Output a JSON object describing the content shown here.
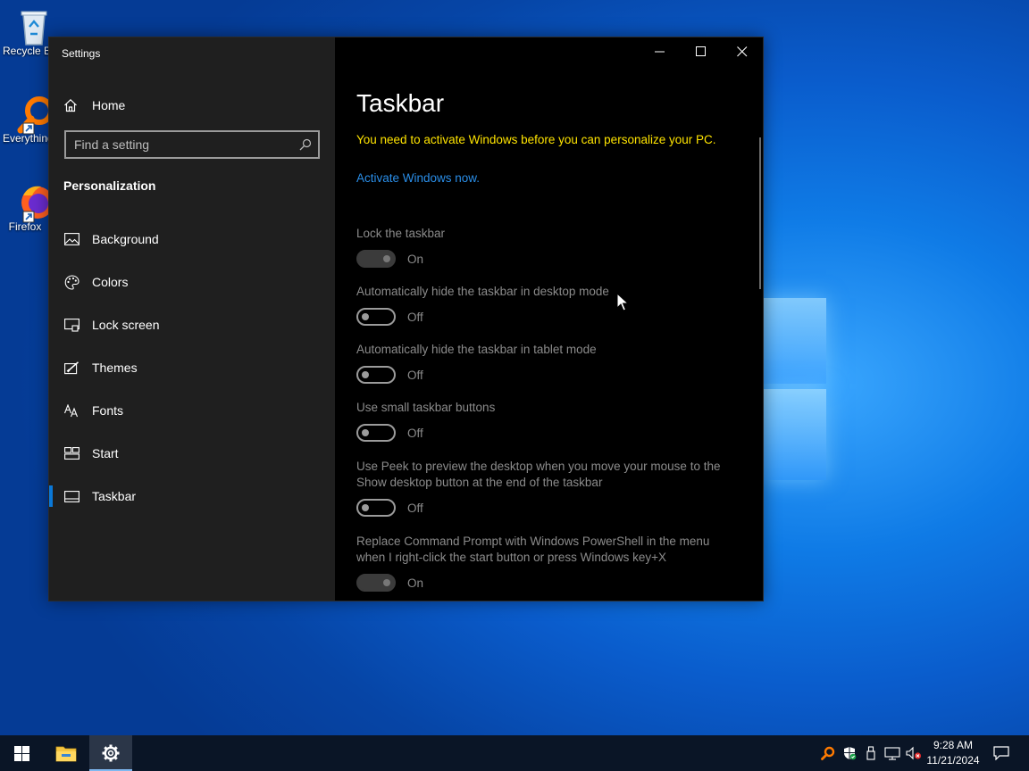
{
  "desktop": {
    "icons": [
      {
        "label": "Recycle Bin",
        "icon": "recycle-bin-icon"
      },
      {
        "label": "Everything",
        "icon": "everything-search-icon"
      },
      {
        "label": "Firefox",
        "icon": "firefox-icon"
      }
    ]
  },
  "window": {
    "title": "Settings",
    "controls": [
      "minimize-icon",
      "maximize-icon",
      "close-icon"
    ]
  },
  "sidebar": {
    "home_label": "Home",
    "search_placeholder": "Find a setting",
    "section_title": "Personalization",
    "items": [
      {
        "label": "Background",
        "icon": "picture-icon",
        "selected": false
      },
      {
        "label": "Colors",
        "icon": "palette-icon",
        "selected": false
      },
      {
        "label": "Lock screen",
        "icon": "lock-screen-icon",
        "selected": false
      },
      {
        "label": "Themes",
        "icon": "themes-brush-icon",
        "selected": false
      },
      {
        "label": "Fonts",
        "icon": "fonts-icon",
        "selected": false
      },
      {
        "label": "Start",
        "icon": "start-tiles-icon",
        "selected": false
      },
      {
        "label": "Taskbar",
        "icon": "taskbar-icon",
        "selected": true
      }
    ]
  },
  "main": {
    "title": "Taskbar",
    "activation_warning": "You need to activate Windows before you can personalize your PC.",
    "activate_link": "Activate Windows now.",
    "settings": [
      {
        "label": "Lock the taskbar",
        "state": "On",
        "on": true
      },
      {
        "label": "Automatically hide the taskbar in desktop mode",
        "state": "Off",
        "on": false
      },
      {
        "label": "Automatically hide the taskbar in tablet mode",
        "state": "Off",
        "on": false
      },
      {
        "label": "Use small taskbar buttons",
        "state": "Off",
        "on": false
      },
      {
        "label": "Use Peek to preview the desktop when you move your mouse to the Show desktop button at the end of the taskbar",
        "state": "Off",
        "on": false
      },
      {
        "label": "Replace Command Prompt with Windows PowerShell in the menu when I right-click the start button or press Windows key+X",
        "state": "On",
        "on": true
      }
    ]
  },
  "taskbar": {
    "time": "9:28 AM",
    "date": "11/21/2024",
    "accent_color": "#0a78d7",
    "warning_color": "#ffe400",
    "link_color": "#2a8ee8"
  }
}
